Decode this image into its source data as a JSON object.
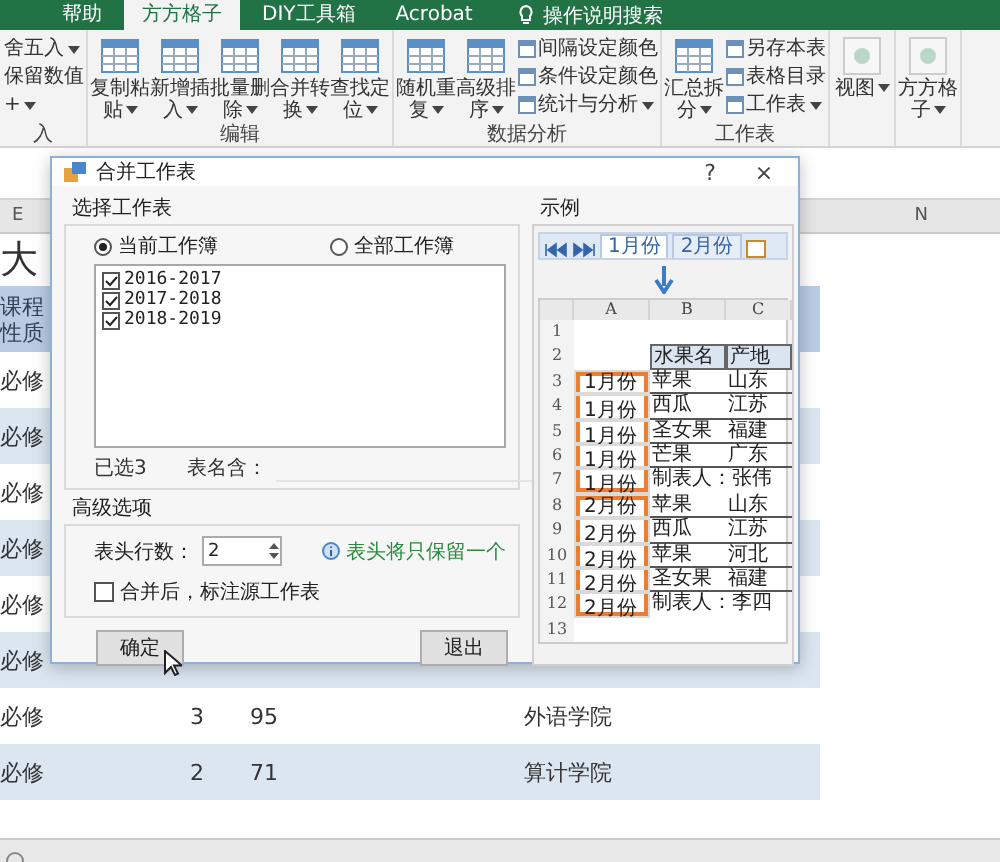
{
  "ribbon": {
    "tabs": [
      {
        "label": "帮助",
        "selected": false
      },
      {
        "label": "方方格子",
        "selected": true
      },
      {
        "label": "DIY工具箱",
        "selected": false
      },
      {
        "label": "Acrobat",
        "selected": false
      }
    ],
    "search": "操作说明搜索",
    "groups": [
      {
        "label": "入",
        "small": [
          {
            "label": "舍五入",
            "kind": "plain",
            "dropdown": true
          },
          {
            "label": "保留数值",
            "kind": "plain",
            "dropdown": false
          },
          {
            "label": "+",
            "kind": "plain",
            "dropdown": true
          }
        ]
      },
      {
        "label": "编辑",
        "big": [
          {
            "label": "复制粘贴",
            "kind": "square",
            "dropdown": true
          },
          {
            "label": "新增插入",
            "kind": "square",
            "dropdown": true
          },
          {
            "label": "批量删除",
            "kind": "square",
            "dropdown": true
          },
          {
            "label": "合并转换",
            "kind": "square",
            "dropdown": true
          },
          {
            "label": "查找定位",
            "kind": "square",
            "dropdown": true
          }
        ]
      },
      {
        "label": "数据分析",
        "big": [
          {
            "label": "随机重复",
            "kind": "square",
            "dropdown": true
          },
          {
            "label": "高级排序",
            "kind": "square",
            "dropdown": true
          }
        ],
        "small": [
          {
            "label": "间隔设定颜色",
            "kind": "icon",
            "dropdown": false
          },
          {
            "label": "条件设定颜色",
            "kind": "icon",
            "dropdown": false
          },
          {
            "label": "统计与分析",
            "kind": "icon",
            "dropdown": true
          }
        ]
      },
      {
        "label": "工作表",
        "big": [
          {
            "label": "汇总拆分",
            "kind": "square",
            "dropdown": true
          }
        ],
        "small": [
          {
            "label": "另存本表",
            "kind": "icon",
            "dropdown": false
          },
          {
            "label": "表格目录",
            "kind": "icon",
            "dropdown": false
          },
          {
            "label": "工作表",
            "kind": "icon",
            "dropdown": true
          }
        ]
      },
      {
        "big": [
          {
            "label": "视图",
            "kind": "round",
            "dropdown": true
          }
        ]
      },
      {
        "big": [
          {
            "label": "方方格子",
            "kind": "round",
            "dropdown": true
          }
        ]
      }
    ]
  },
  "sheet": {
    "columns": [
      "E",
      "N"
    ],
    "rows": [
      {
        "kind": "title",
        "cells": [
          "大"
        ]
      },
      {
        "kind": "header",
        "cells": [
          "课程性质"
        ]
      },
      {
        "kind": "data",
        "cells": [
          "必修"
        ]
      },
      {
        "kind": "data",
        "cells": [
          "必修"
        ]
      },
      {
        "kind": "data",
        "cells": [
          "必修"
        ]
      },
      {
        "kind": "data",
        "cells": [
          "必修"
        ]
      },
      {
        "kind": "data",
        "cells": [
          "必修"
        ]
      },
      {
        "kind": "data",
        "cells": [
          "必修"
        ]
      },
      {
        "kind": "data",
        "cells": [
          "必修",
          "3",
          "95",
          "外语学院"
        ]
      },
      {
        "kind": "data",
        "cells": [
          "必修",
          "2",
          "71",
          "算计学院"
        ]
      }
    ]
  },
  "dialog": {
    "title": "合并工作表",
    "help": "?",
    "close": "×",
    "select_group": {
      "title": "选择工作表",
      "options": [
        {
          "label": "当前工作簿",
          "selected": true
        },
        {
          "label": "全部工作簿",
          "selected": false
        }
      ],
      "sheets": [
        {
          "label": "2016-2017",
          "checked": true
        },
        {
          "label": "2017-2018",
          "checked": true
        },
        {
          "label": "2018-2019",
          "checked": true
        }
      ],
      "selected_count": "已选3",
      "name_filter_label": "表名含："
    },
    "advanced": {
      "title": "高级选项",
      "header_rows_label": "表头行数：",
      "header_rows": "2",
      "hint": "表头将只保留一个",
      "mark_source": {
        "label": "合并后，标注源工作表",
        "checked": false
      }
    },
    "buttons": [
      "确定",
      "退出"
    ],
    "example": {
      "title": "示例",
      "sheet_tabs": [
        {
          "label": "1月份",
          "selected": true
        },
        {
          "label": "2月份",
          "selected": false
        }
      ],
      "columns": [
        "A",
        "B",
        "C"
      ],
      "sections": [
        {
          "kind": "plain",
          "rows": [
            {
              "num": "1"
            },
            {
              "num": "2",
              "b": "水果名",
              "c": "产地",
              "heading": true
            }
          ]
        },
        {
          "kind": "boxed",
          "rows": [
            {
              "num": "3",
              "a": "1月份",
              "b": "苹果",
              "c": "山东"
            },
            {
              "num": "4",
              "a": "1月份",
              "b": "西瓜",
              "c": "江苏"
            },
            {
              "num": "5",
              "a": "1月份",
              "b": "圣女果",
              "c": "福建"
            },
            {
              "num": "6",
              "a": "1月份",
              "b": "芒果",
              "c": "广东"
            },
            {
              "num": "7",
              "a": "1月份",
              "note": "制表人：张伟"
            }
          ]
        },
        {
          "kind": "boxed",
          "rows": [
            {
              "num": "8",
              "a": "2月份",
              "b": "苹果",
              "c": "山东"
            },
            {
              "num": "9",
              "a": "2月份",
              "b": "西瓜",
              "c": "江苏"
            },
            {
              "num": "10",
              "a": "2月份",
              "b": "苹果",
              "c": "河北"
            },
            {
              "num": "11",
              "a": "2月份",
              "b": "圣女果",
              "c": "福建"
            },
            {
              "num": "12",
              "a": "2月份",
              "note": "制表人：李四"
            }
          ]
        },
        {
          "kind": "plain",
          "rows": [
            {
              "num": "13"
            }
          ]
        }
      ]
    }
  }
}
